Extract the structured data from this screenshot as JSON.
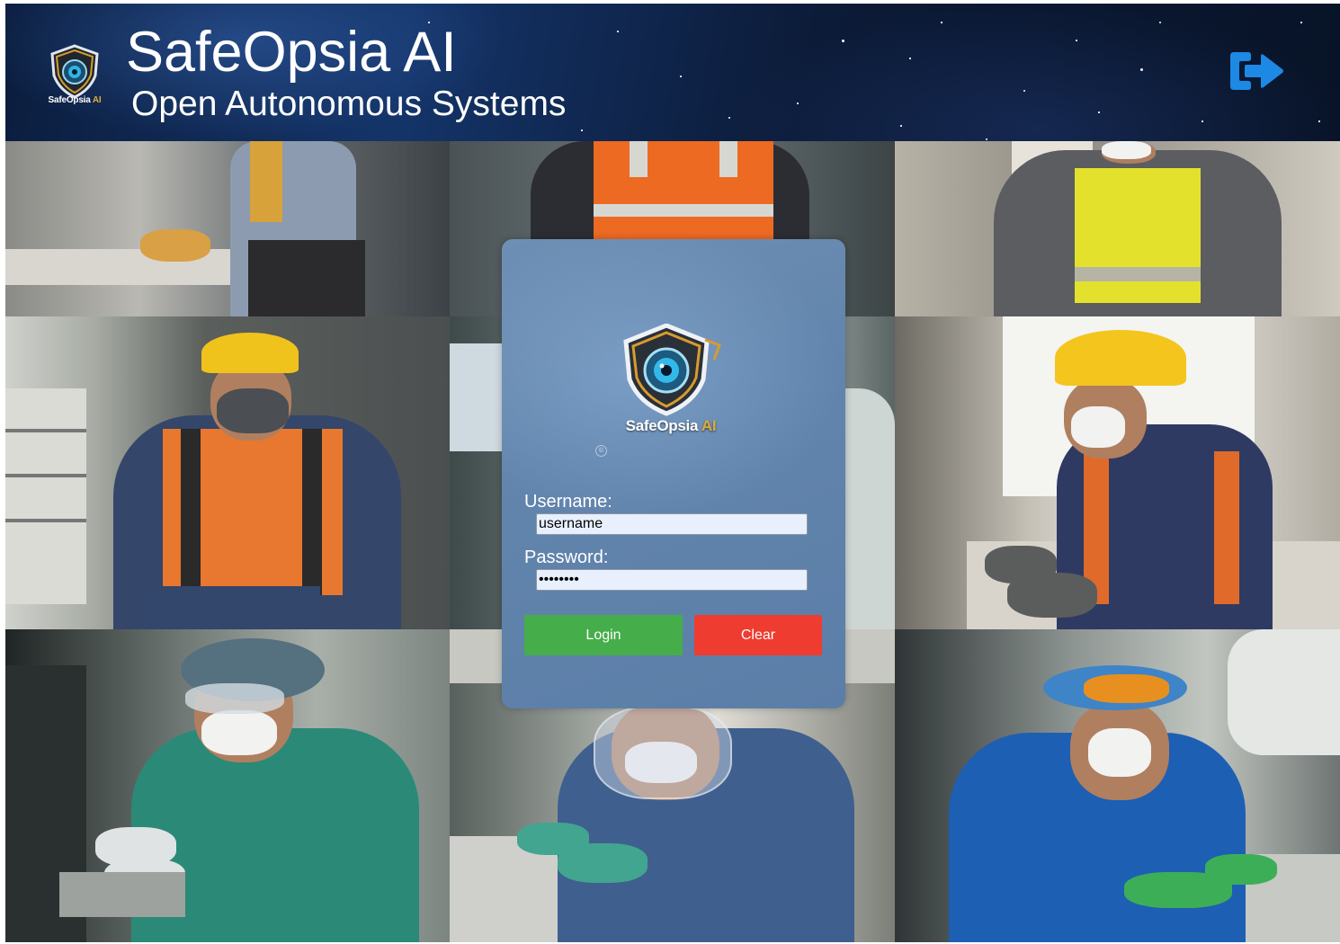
{
  "header": {
    "title": "SafeOpsia AI",
    "subtitle": "Open Autonomous Systems",
    "logo": {
      "name_prefix": "SafeOpsia",
      "name_suffix": "AI"
    },
    "logout_icon": "sign-out-arrow-icon"
  },
  "background": {
    "photos": [
      {
        "subject": "worker-orange-gloves"
      },
      {
        "subject": "worker-orange-vest"
      },
      {
        "subject": "worker-yellow-vest"
      },
      {
        "subject": "worker-respirator-orange-vest"
      },
      {
        "subject": "lab-equipment"
      },
      {
        "subject": "worker-yellow-helmet-lab"
      },
      {
        "subject": "medical-green-gown"
      },
      {
        "subject": "medical-face-shield"
      },
      {
        "subject": "dental-blue-gown"
      }
    ]
  },
  "login": {
    "logo": {
      "name_prefix": "SafeOpsia",
      "name_suffix": "AI"
    },
    "username_label": "Username:",
    "username_value": "username",
    "password_label": "Password:",
    "password_value": "password",
    "login_label": "Login",
    "clear_label": "Clear"
  },
  "colors": {
    "header_bg": "#0b1d3d",
    "logout_icon": "#1e88e5",
    "login_button": "#46ad4b",
    "clear_button": "#ee3c30",
    "card_bg": "#6285ad",
    "input_bg": "#e8f0fe"
  }
}
